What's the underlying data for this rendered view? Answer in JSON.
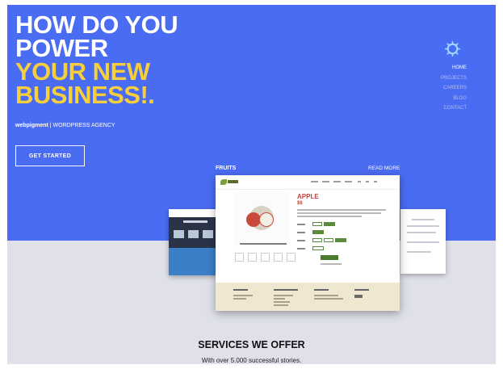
{
  "hero": {
    "headline_line1": "HOW DO YOU",
    "headline_line2": "POWER",
    "headline_line3": "YOUR NEW",
    "headline_line4": "BUSINESS!.",
    "brand": "webpigment",
    "tagline": " | WORDPRESS AGENCY",
    "cta_label": "GET STARTED"
  },
  "nav": {
    "items": [
      "HOME",
      "PROJECTS",
      "CAREERS",
      "BLOG",
      "CONTACT"
    ],
    "active": "HOME"
  },
  "portfolio": {
    "label": "FRUITS",
    "read_more": "READ MORE",
    "product_title": "APPLE",
    "product_price": "$6"
  },
  "services": {
    "title": "SERVICES WE OFFER",
    "subtitle": "With over 5.000 successful stories."
  },
  "colors": {
    "hero_bg": "#4a6cf2",
    "accent_yellow": "#f7cf3a",
    "lower_bg": "#dfe0ea",
    "product_red": "#c2453b",
    "product_green": "#5c8a3c"
  }
}
